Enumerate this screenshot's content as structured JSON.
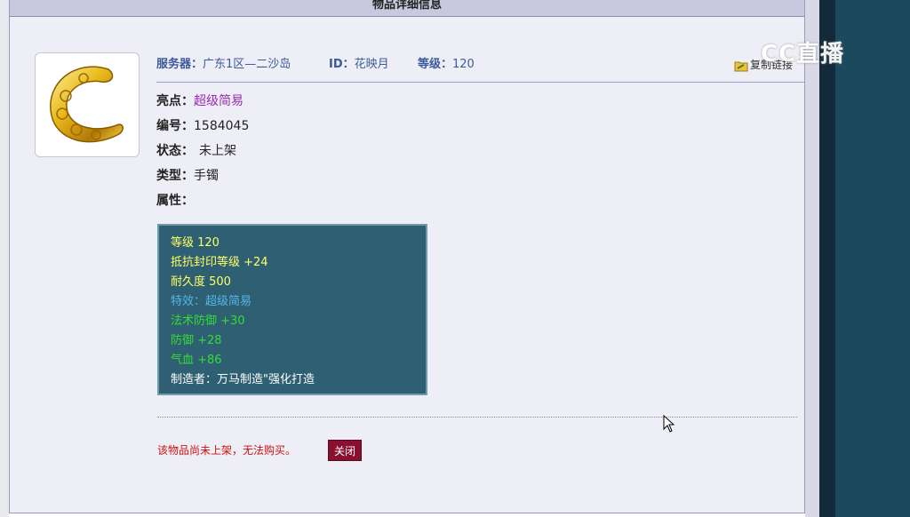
{
  "panel": {
    "title": "物品详细信息"
  },
  "info_bar": {
    "server_label": "服务器：",
    "server_value": "广东1区—二沙岛",
    "id_label": "ID：",
    "id_value": "花映月",
    "level_label": "等级：",
    "level_value": "120",
    "copy_link_label": "复制链接"
  },
  "fields": {
    "highlight_label": "亮点：",
    "highlight_value": "超级简易",
    "number_label": "编号：",
    "number_value": "1584045",
    "status_label": "状态：",
    "status_value": "未上架",
    "type_label": "类型：",
    "type_value": "手镯",
    "attr_label": "属性："
  },
  "attributes": [
    {
      "text": "等级 120",
      "color": "#ffff66"
    },
    {
      "text": "抵抗封印等级 +24",
      "color": "#ffff66"
    },
    {
      "text": "耐久度 500",
      "color": "#ffff66"
    },
    {
      "text": "特效：超级简易",
      "color": "#55b6e8"
    },
    {
      "text": "法术防御 +30",
      "color": "#33dd33"
    },
    {
      "text": "防御 +28",
      "color": "#33dd33"
    },
    {
      "text": "气血 +86",
      "color": "#33dd33"
    },
    {
      "text": "制造者：万马制造\"强化打造",
      "color": "#ffffff"
    }
  ],
  "footer": {
    "notice": "该物品尚未上架，无法购买。",
    "close_label": "关闭"
  },
  "watermark": {
    "text": "CC直播"
  },
  "item_image": {
    "icon": "gold-bracelet-icon"
  }
}
